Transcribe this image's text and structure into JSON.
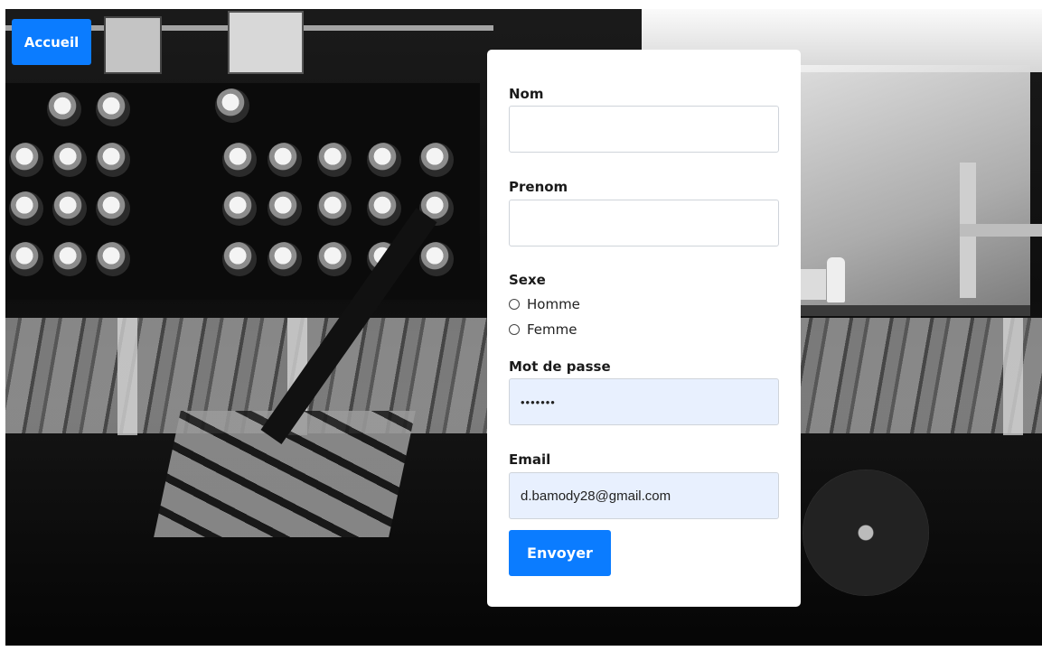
{
  "nav": {
    "home_label": "Accueil"
  },
  "form": {
    "nom": {
      "label": "Nom",
      "value": ""
    },
    "prenom": {
      "label": "Prenom",
      "value": ""
    },
    "sexe": {
      "label": "Sexe",
      "options": [
        {
          "label": "Homme",
          "checked": false
        },
        {
          "label": "Femme",
          "checked": false
        }
      ]
    },
    "password": {
      "label": "Mot de passe",
      "value": "•••••••"
    },
    "email": {
      "label": "Email",
      "value": "d.bamody28@gmail.com"
    },
    "submit_label": "Envoyer"
  },
  "colors": {
    "primary": "#0b7cff",
    "autofill_bg": "#e8f0fe",
    "card_bg": "#ffffff"
  }
}
